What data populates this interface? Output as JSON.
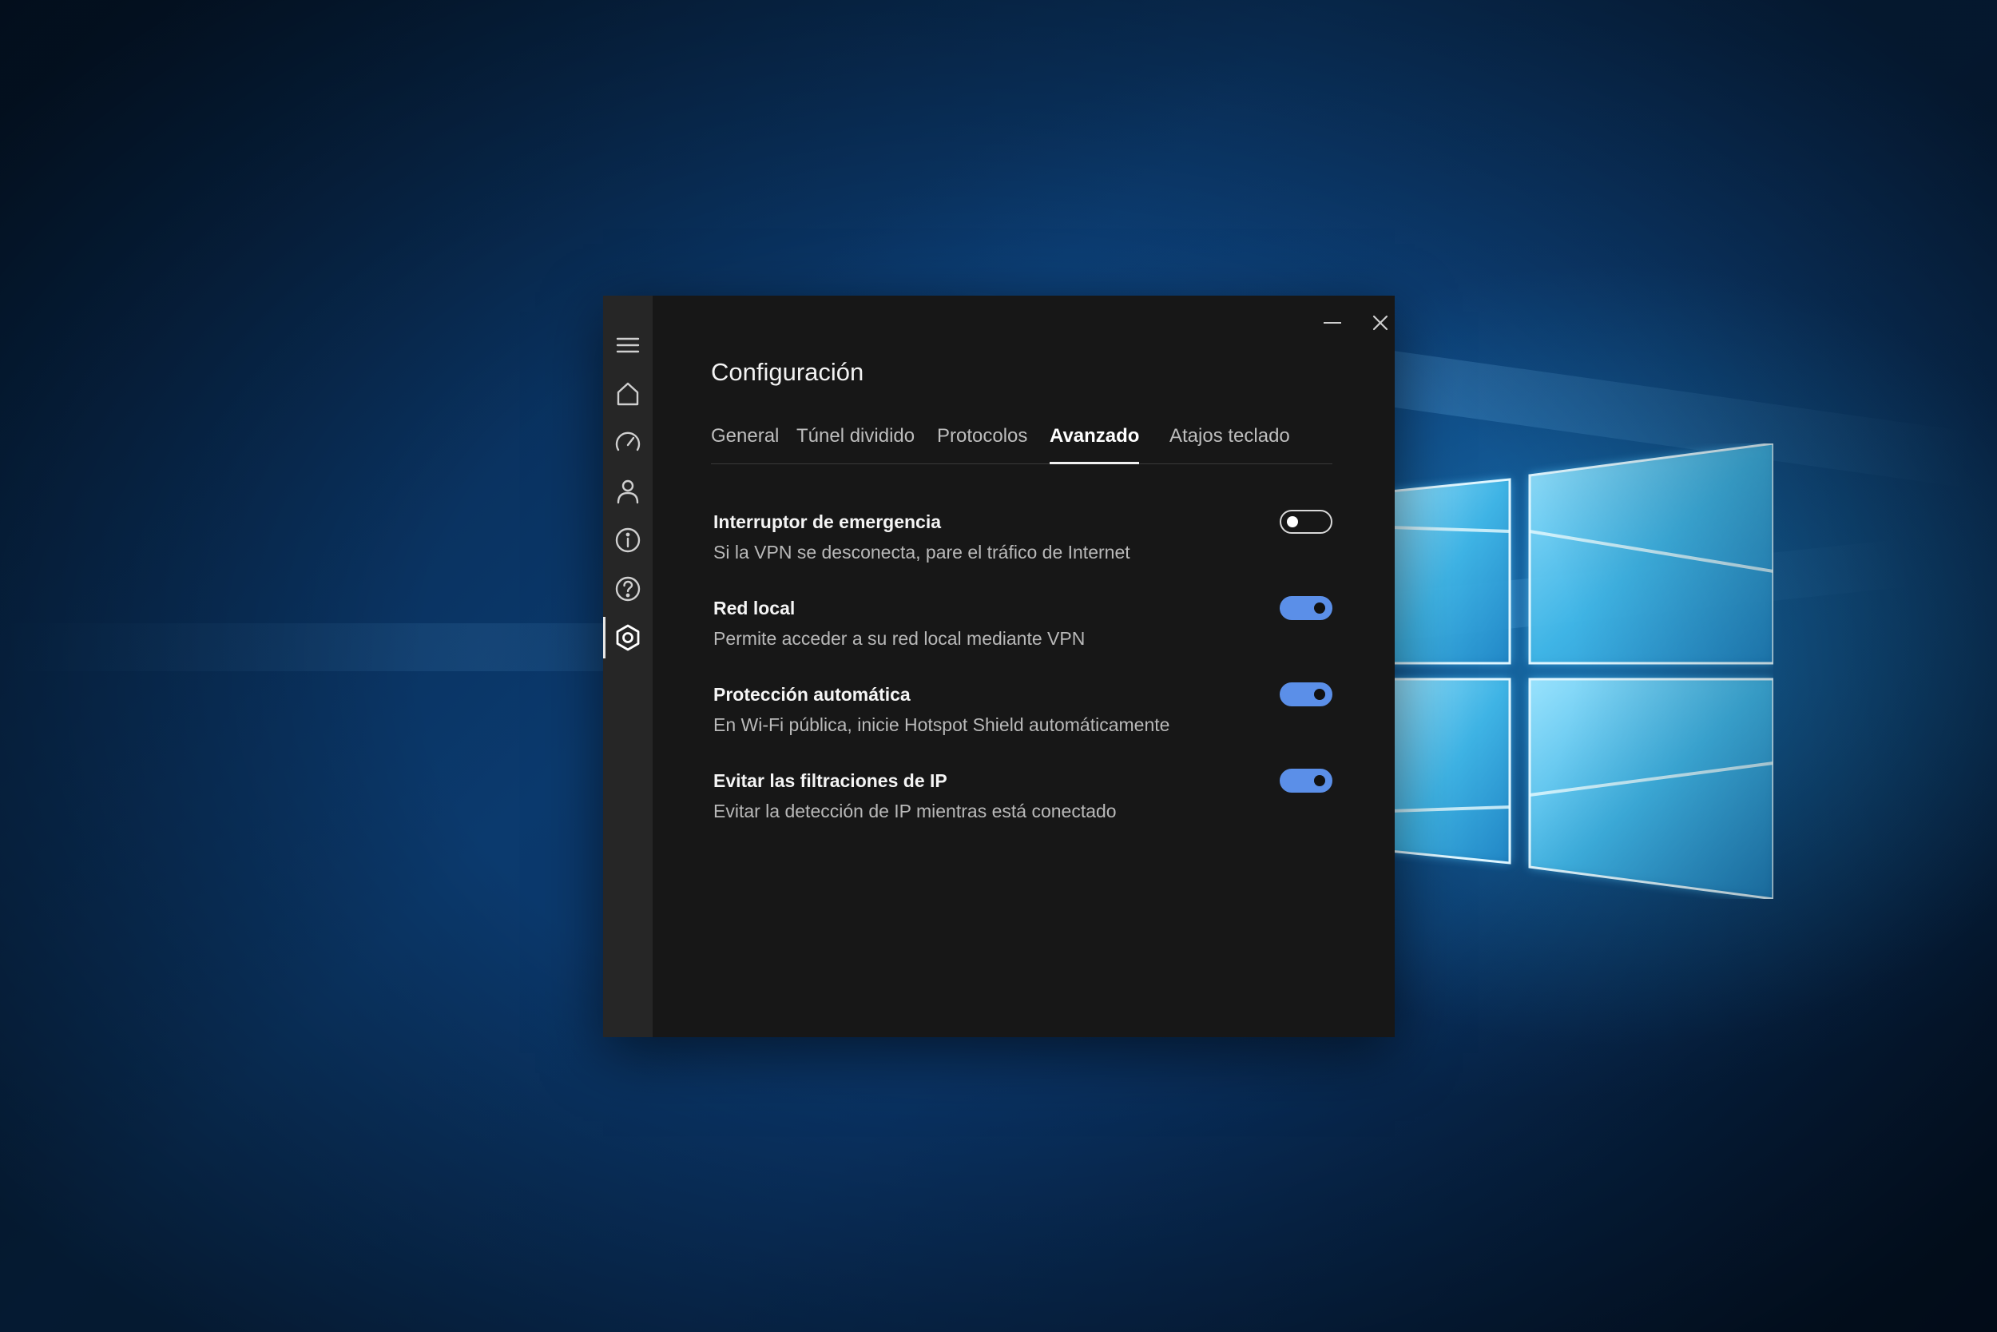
{
  "desktop": {
    "wallpaper": "windows-10-hero",
    "accent": "#0b3a6e"
  },
  "window": {
    "title": "Configuración",
    "controls": {
      "minimize_icon": "minimize-icon",
      "close_icon": "close-icon"
    }
  },
  "sidebar": {
    "items": [
      {
        "icon": "hamburger-menu-icon",
        "active": false
      },
      {
        "icon": "home-icon",
        "active": false
      },
      {
        "icon": "speed-gauge-icon",
        "active": false
      },
      {
        "icon": "account-icon",
        "active": false
      },
      {
        "icon": "info-icon",
        "active": false
      },
      {
        "icon": "help-icon",
        "active": false
      },
      {
        "icon": "settings-gear-icon",
        "active": true
      }
    ]
  },
  "tabs": [
    {
      "label": "General",
      "active": false
    },
    {
      "label": "Túnel dividido",
      "active": false
    },
    {
      "label": "Protocolos",
      "active": false
    },
    {
      "label": "Avanzado",
      "active": true
    },
    {
      "label": "Atajos teclado",
      "active": false
    }
  ],
  "settings": [
    {
      "title": "Interruptor de emergencia",
      "description": "Si la VPN se desconecta, pare el tráfico de Internet",
      "enabled": false
    },
    {
      "title": "Red local",
      "description": "Permite acceder a su red local mediante VPN",
      "enabled": true
    },
    {
      "title": "Protección automática",
      "description": "En Wi-Fi pública, inicie Hotspot Shield automáticamente",
      "enabled": true
    },
    {
      "title": "Evitar las filtraciones de IP",
      "description": "Evitar la detección de IP mientras está conectado",
      "enabled": true
    }
  ],
  "colors": {
    "toggle_on": "#5b8fe8",
    "window_bg": "#171717",
    "rail_bg": "#262626"
  }
}
